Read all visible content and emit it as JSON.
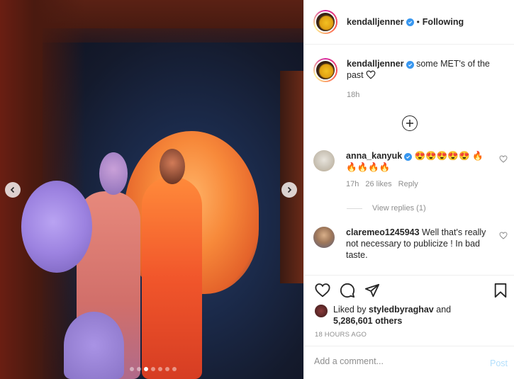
{
  "post": {
    "carousel": {
      "slide_count": 7,
      "active_index": 3
    },
    "author": {
      "username": "kendalljenner",
      "verified": true
    },
    "follow_state": "Following",
    "separator": "•",
    "caption": {
      "username": "kendalljenner",
      "text": "some MET's of the past",
      "time": "18h"
    },
    "comments": [
      {
        "username": "anna_kanyuk",
        "verified": true,
        "text": "😍😍😍😍😍 🔥🔥🔥🔥🔥",
        "time": "17h",
        "likes": "26 likes",
        "reply": "Reply",
        "view_replies": "View replies (1)"
      },
      {
        "username": "claremeo1245943",
        "verified": false,
        "text": "Well that's really not necessary to publicize ! In bad taste."
      }
    ],
    "liked_by": {
      "prefix": "Liked by",
      "user": "styledbyraghav",
      "and": "and",
      "others": "5,286,601 others"
    },
    "timestamp": "18 HOURS AGO",
    "add_comment": {
      "placeholder": "Add a comment...",
      "post_label": "Post"
    }
  },
  "colors": {
    "link_blue": "#3897f0",
    "post_disabled": "#b2dffc",
    "muted": "#8e8e8e"
  }
}
